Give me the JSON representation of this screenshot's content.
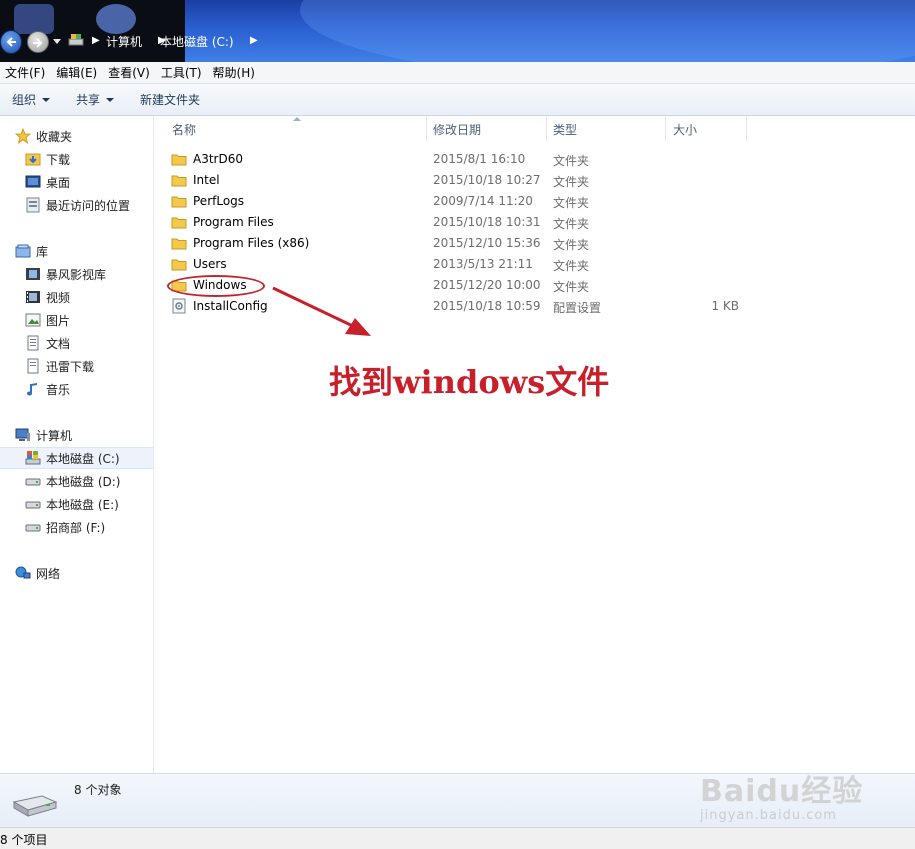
{
  "address": {
    "crumbs": [
      "计算机",
      "本地磁盘 (C:)"
    ]
  },
  "menu": [
    "文件(F)",
    "编辑(E)",
    "查看(V)",
    "工具(T)",
    "帮助(H)"
  ],
  "toolbar": {
    "organize": "组织",
    "share": "共享",
    "new_folder": "新建文件夹"
  },
  "nav": {
    "favorites": {
      "label": "收藏夹",
      "items": [
        "下载",
        "桌面",
        "最近访问的位置"
      ]
    },
    "libraries": {
      "label": "库",
      "items": [
        "暴风影视库",
        "视频",
        "图片",
        "文档",
        "迅雷下载",
        "音乐"
      ]
    },
    "computer": {
      "label": "计算机",
      "items": [
        "本地磁盘 (C:)",
        "本地磁盘 (D:)",
        "本地磁盘 (E:)",
        "招商部 (F:)"
      ]
    },
    "network": {
      "label": "网络"
    }
  },
  "columns": {
    "name": "名称",
    "date": "修改日期",
    "type": "类型",
    "size": "大小"
  },
  "files": [
    {
      "name": "A3trD60",
      "date": "2015/8/1 16:10",
      "type": "文件夹",
      "size": "",
      "icon": "folder-icon"
    },
    {
      "name": "Intel",
      "date": "2015/10/18 10:27",
      "type": "文件夹",
      "size": "",
      "icon": "folder-icon"
    },
    {
      "name": "PerfLogs",
      "date": "2009/7/14 11:20",
      "type": "文件夹",
      "size": "",
      "icon": "folder-icon"
    },
    {
      "name": "Program Files",
      "date": "2015/10/18 10:31",
      "type": "文件夹",
      "size": "",
      "icon": "folder-icon"
    },
    {
      "name": "Program Files (x86)",
      "date": "2015/12/10 15:36",
      "type": "文件夹",
      "size": "",
      "icon": "folder-icon"
    },
    {
      "name": "Users",
      "date": "2013/5/13 21:11",
      "type": "文件夹",
      "size": "",
      "icon": "folder-icon"
    },
    {
      "name": "Windows",
      "date": "2015/12/20 10:00",
      "type": "文件夹",
      "size": "",
      "icon": "folder-icon"
    },
    {
      "name": "InstallConfig",
      "date": "2015/10/18 10:59",
      "type": "配置设置",
      "size": "1 KB",
      "icon": "config-file-icon"
    }
  ],
  "annotation": "找到windows文件",
  "details": {
    "count": "8 个对象"
  },
  "status": {
    "text": "8 个项目"
  },
  "watermark": {
    "main": "Baidu经验",
    "sub": "jingyan.baidu.com"
  },
  "colors": {
    "annotation_red": "#c8202b",
    "title_blue": "#2a5fd0",
    "folder_yellow": "#f2c94c"
  }
}
